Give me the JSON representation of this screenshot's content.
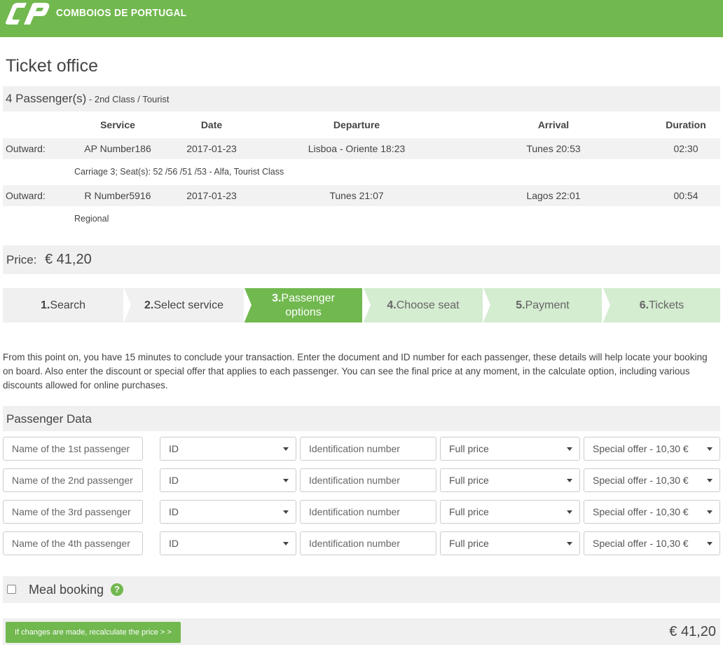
{
  "header": {
    "brand": "COMBOIOS DE PORTUGAL",
    "logo_icon": "cp-logo",
    "color": "#71b84f"
  },
  "page_title": "Ticket office",
  "passengers_summary": {
    "count": "4 Passenger(s)",
    "class": " - 2nd Class / Tourist"
  },
  "journey_table": {
    "headers": [
      "Service",
      "Date",
      "Departure",
      "Arrival",
      "Duration"
    ],
    "rows": [
      {
        "direction": "Outward:",
        "service": "AP Number186",
        "date": "2017-01-23",
        "departure": "Lisboa - Oriente 18:23",
        "arrival": "Tunes 20:53",
        "duration": "02:30",
        "details": "Carriage 3; Seat(s): 52 /56 /51 /53   -   Alfa, Tourist Class"
      },
      {
        "direction": "Outward:",
        "service": "R Number5916",
        "date": "2017-01-23",
        "departure": "Tunes 21:07",
        "arrival": "Lagos 22:01",
        "duration": "00:54",
        "details": "Regional"
      }
    ]
  },
  "price": {
    "label": "Price:",
    "value": "€ 41,20"
  },
  "steps": [
    {
      "num": "1.",
      "label": "Search",
      "state": "done"
    },
    {
      "num": "2.",
      "label": "Select service",
      "state": "done"
    },
    {
      "num": "3.",
      "label": "Passenger",
      "label2": "options",
      "state": "active"
    },
    {
      "num": "4.",
      "label": "Choose seat",
      "state": "todo"
    },
    {
      "num": "5.",
      "label": "Payment",
      "state": "todo"
    },
    {
      "num": "6.",
      "label": "Tickets",
      "state": "todo"
    }
  ],
  "intro_text": "From this point on, you have 15 minutes to conclude your transaction. Enter the document and ID number for each passenger, these details will help locate your booking on board. Also enter the discount or special offer that applies to each passenger. You can see the final price at any moment, in the calculate option, including various discounts allowed for online purchases.",
  "passenger_data": {
    "title": "Passenger Data",
    "rows": [
      {
        "name_placeholder": "Name of the 1st passenger",
        "doc_type": "ID",
        "id_placeholder": "Identification number",
        "fare": "Full price",
        "offer": "Special offer - 10,30 €"
      },
      {
        "name_placeholder": "Name of the 2nd passenger",
        "doc_type": "ID",
        "id_placeholder": "Identification number",
        "fare": "Full price",
        "offer": "Special offer - 10,30 €"
      },
      {
        "name_placeholder": "Name of the 3rd passenger",
        "doc_type": "ID",
        "id_placeholder": "Identification number",
        "fare": "Full price",
        "offer": "Special offer - 10,30 €"
      },
      {
        "name_placeholder": "Name of the 4th passenger",
        "doc_type": "ID",
        "id_placeholder": "Identification number",
        "fare": "Full price",
        "offer": "Special offer - 10,30 €"
      }
    ]
  },
  "meal": {
    "label": "Meal booking",
    "help": "?",
    "checked": false
  },
  "footer": {
    "recalc_label": "If changes are made, recalculate the price > >",
    "total": "€ 41,20"
  }
}
